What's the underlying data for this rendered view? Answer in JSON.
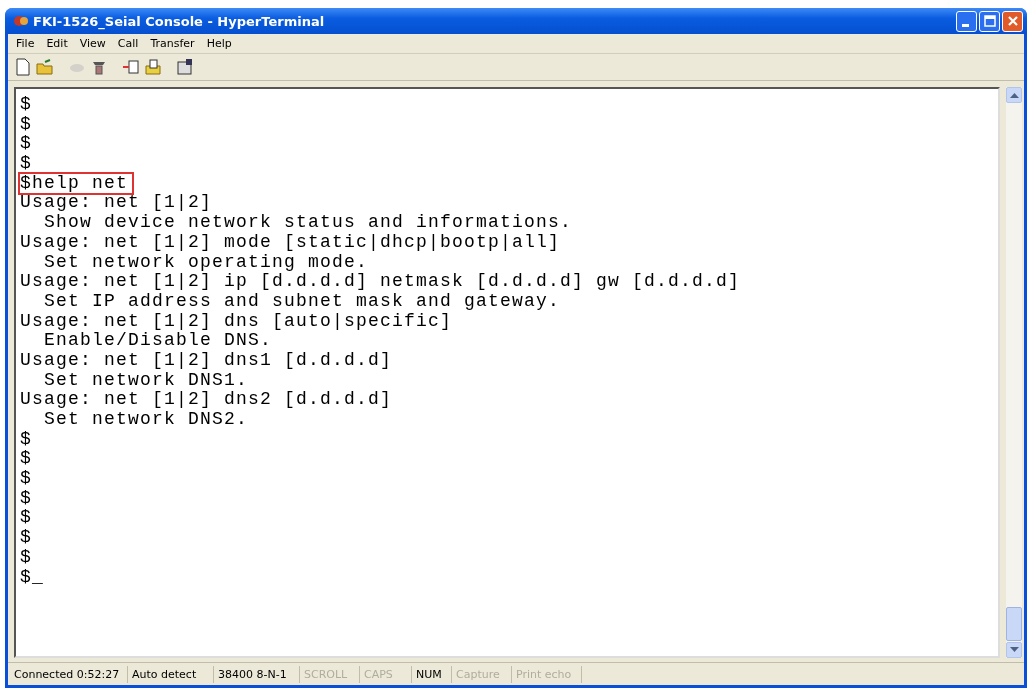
{
  "window": {
    "title": "FKI-1526_Seial Console - HyperTerminal"
  },
  "menu": [
    "File",
    "Edit",
    "View",
    "Call",
    "Transfer",
    "Help"
  ],
  "toolbar": [
    {
      "kind": "new",
      "disabled": false
    },
    {
      "kind": "open",
      "disabled": false
    },
    {
      "kind": "disconnect",
      "disabled": true
    },
    {
      "kind": "dial",
      "disabled": false
    },
    {
      "kind": "send",
      "disabled": false
    },
    {
      "kind": "receive",
      "disabled": false
    },
    {
      "kind": "properties",
      "disabled": false
    }
  ],
  "terminal": {
    "lines": [
      {
        "text": "$",
        "highlighted": false
      },
      {
        "text": "$",
        "highlighted": false
      },
      {
        "text": "$",
        "highlighted": false
      },
      {
        "text": "$",
        "highlighted": false
      },
      {
        "text": "$help net",
        "highlighted": true
      },
      {
        "text": "Usage: net [1|2]",
        "highlighted": false
      },
      {
        "text": "  Show device network status and informations.",
        "highlighted": false
      },
      {
        "text": "Usage: net [1|2] mode [static|dhcp|bootp|all]",
        "highlighted": false
      },
      {
        "text": "  Set network operating mode.",
        "highlighted": false
      },
      {
        "text": "Usage: net [1|2] ip [d.d.d.d] netmask [d.d.d.d] gw [d.d.d.d]",
        "highlighted": false
      },
      {
        "text": "  Set IP address and subnet mask and gateway.",
        "highlighted": false
      },
      {
        "text": "Usage: net [1|2] dns [auto|specific]",
        "highlighted": false
      },
      {
        "text": "  Enable/Disable DNS.",
        "highlighted": false
      },
      {
        "text": "Usage: net [1|2] dns1 [d.d.d.d]",
        "highlighted": false
      },
      {
        "text": "  Set network DNS1.",
        "highlighted": false
      },
      {
        "text": "Usage: net [1|2] dns2 [d.d.d.d]",
        "highlighted": false
      },
      {
        "text": "  Set network DNS2.",
        "highlighted": false
      },
      {
        "text": "$",
        "highlighted": false
      },
      {
        "text": "$",
        "highlighted": false
      },
      {
        "text": "$",
        "highlighted": false
      },
      {
        "text": "$",
        "highlighted": false
      },
      {
        "text": "$",
        "highlighted": false
      },
      {
        "text": "$",
        "highlighted": false
      },
      {
        "text": "$",
        "highlighted": false
      },
      {
        "text": "$_",
        "highlighted": false
      }
    ]
  },
  "status_bar": [
    {
      "text": "Connected 0:52:27",
      "disabled": false
    },
    {
      "text": "Auto detect",
      "disabled": false
    },
    {
      "text": "38400 8-N-1",
      "disabled": false
    },
    {
      "text": "SCROLL",
      "disabled": true
    },
    {
      "text": "CAPS",
      "disabled": true
    },
    {
      "text": "NUM",
      "disabled": false
    },
    {
      "text": "Capture",
      "disabled": true
    },
    {
      "text": "Print echo",
      "disabled": true
    }
  ]
}
